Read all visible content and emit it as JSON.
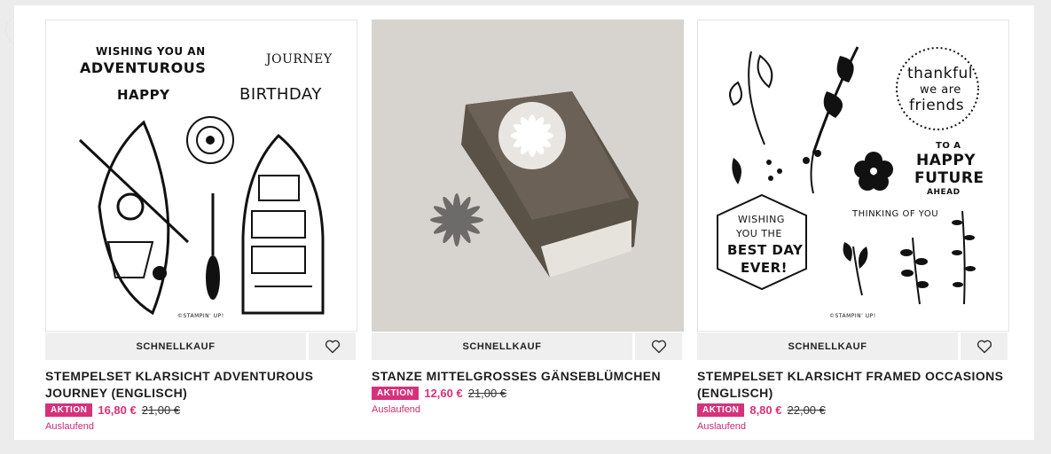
{
  "products": [
    {
      "image": {
        "alt": "adventurous-journey-stamp-set",
        "texts": [
          "WISHING YOU AN",
          "ADVENTUROUS",
          "JOURNEY",
          "HAPPY",
          "BIRTHDAY",
          "©STAMPIN' UP!"
        ]
      },
      "quick_label": "SCHNELLKAUF",
      "title": "STEMPELSET KLARSICHT ADVENTUROUS JOURNEY (ENGLISCH)",
      "badge": "AKTION",
      "price": "16,80 €",
      "old_price": "21,00 €",
      "status": "Auslaufend"
    },
    {
      "image": {
        "alt": "daisy-punch"
      },
      "quick_label": "SCHNELLKAUF",
      "title": "STANZE MITTELGROSSES GÄNSEBLÜMCHEN",
      "badge": "AKTION",
      "price": "12,60 €",
      "old_price": "21,00 €",
      "status": "Auslaufend"
    },
    {
      "image": {
        "alt": "framed-occasions-stamp-set",
        "texts": [
          "thankful",
          "we are",
          "friends",
          "TO A",
          "HAPPY",
          "FUTURE",
          "AHEAD",
          "THINKING OF YOU",
          "WISHING",
          "YOU THE",
          "BEST DAY",
          "EVER!",
          "©STAMPIN' UP!"
        ]
      },
      "quick_label": "SCHNELLKAUF",
      "title": "STEMPELSET KLARSICHT FRAMED OCCASIONS (ENGLISCH)",
      "badge": "AKTION",
      "price": "8,80 €",
      "old_price": "22,00 €",
      "status": "Auslaufend"
    }
  ],
  "colors": {
    "accent": "#d6317a",
    "button_bg": "#efefef",
    "photo_bg": "#d7d4cf",
    "punch": "#5a5147"
  },
  "icons": {
    "wishlist": "heart-icon"
  }
}
